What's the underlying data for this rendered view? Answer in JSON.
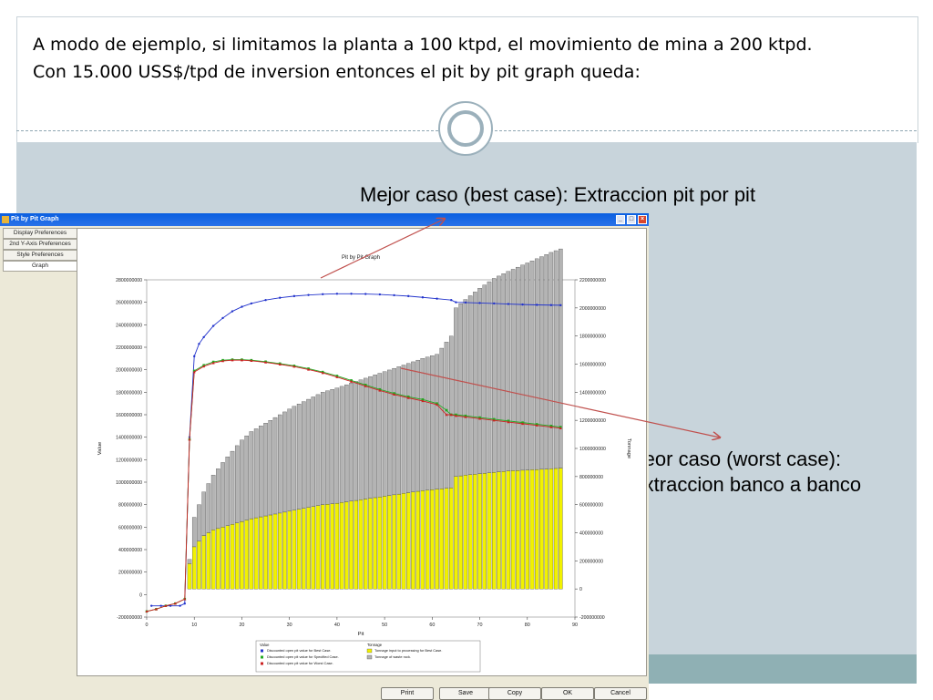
{
  "slide": {
    "intro_line1": "A modo de ejemplo, si limitamos la planta a 100 ktpd, el movimiento de mina a 200 ktpd.",
    "intro_line2": "Con 15.000 USS$/tpd de inversion entonces el pit by pit graph queda:",
    "callout_best": "Mejor caso (best case): Extraccion pit por pit",
    "callout_worst_line1": "Peor caso (worst case):",
    "callout_worst_line2": "Extraccion banco a banco",
    "accent_color": "#c0504d"
  },
  "window": {
    "title": "Pit by Pit Graph",
    "nav": [
      "Display Preferences",
      "2nd Y-Axis Preferences",
      "Style Preferences",
      "Graph"
    ],
    "buttons": {
      "print": "Print",
      "save": "Save",
      "copy": "Copy",
      "ok": "OK",
      "cancel": "Cancel"
    }
  },
  "chart_data": {
    "type": "bar",
    "title": "Pit by Pit Graph",
    "xlabel": "Pit",
    "ylabel": "Value",
    "y2label": "Tonnage",
    "xlim": [
      0,
      90
    ],
    "ylim": [
      -200000000,
      2800000000
    ],
    "y2lim": [
      -200000000,
      2200000000
    ],
    "x_ticks": [
      "0",
      "10",
      "20",
      "30",
      "40",
      "50",
      "60",
      "70",
      "80",
      "90"
    ],
    "y_ticks": [
      "-200000000",
      "0",
      "200000000",
      "400000000",
      "600000000",
      "800000000",
      "1000000000",
      "1200000000",
      "1400000000",
      "1600000000",
      "1800000000",
      "2000000000",
      "2200000000",
      "2400000000",
      "2600000000",
      "2800000000"
    ],
    "y2_ticks": [
      "-200000000",
      "0",
      "200000000",
      "400000000",
      "600000000",
      "800000000",
      "1000000000",
      "1200000000",
      "1400000000",
      "1600000000",
      "1800000000",
      "2000000000",
      "2200000000"
    ],
    "legend": {
      "value_header": "Value",
      "tonnage_header": "Tonnage",
      "position": "bottom-center",
      "items": [
        {
          "label": "Discounted open pit value for Best Case.",
          "color": "#2233cc",
          "marker": "star"
        },
        {
          "label": "Discounted open pit value for Specified Case.",
          "color": "#22aa22",
          "marker": "square"
        },
        {
          "label": "Discounted open pit value for Worst Case.",
          "color": "#cc2222",
          "marker": "triangle"
        },
        {
          "label": "Tonnage input to processing for Best Case.",
          "color": "#f2f200",
          "marker": "box"
        },
        {
          "label": "Tonnage of waste rock.",
          "color": "#b4b4b4",
          "marker": "box"
        }
      ]
    },
    "series": [
      {
        "name": "Discounted open pit value for Best Case.",
        "axis": "left",
        "x": [
          1,
          3,
          5,
          7,
          8,
          9,
          10,
          11,
          12,
          14,
          16,
          18,
          20,
          22,
          25,
          28,
          31,
          34,
          37,
          40,
          43,
          46,
          49,
          52,
          55,
          58,
          61,
          64,
          65,
          67,
          70,
          73,
          76,
          79,
          82,
          85,
          87
        ],
        "y": [
          -100000000,
          -100000000,
          -100000000,
          -100000000,
          -80000000,
          1400000000,
          2120000000,
          2230000000,
          2290000000,
          2390000000,
          2460000000,
          2520000000,
          2560000000,
          2590000000,
          2620000000,
          2640000000,
          2655000000,
          2665000000,
          2672000000,
          2676000000,
          2676000000,
          2674000000,
          2670000000,
          2663000000,
          2655000000,
          2644000000,
          2632000000,
          2620000000,
          2600000000,
          2598000000,
          2594000000,
          2590000000,
          2585000000,
          2580000000,
          2577000000,
          2575000000,
          2574000000
        ]
      },
      {
        "name": "Discounted open pit value for Specified Case.",
        "axis": "left",
        "x": [
          0,
          2,
          4,
          6,
          8,
          9,
          10,
          12,
          14,
          16,
          18,
          20,
          22,
          25,
          28,
          31,
          34,
          37,
          40,
          43,
          46,
          49,
          52,
          55,
          58,
          61,
          63,
          64,
          65,
          67,
          70,
          73,
          76,
          79,
          82,
          85,
          87
        ],
        "y": [
          -150000000,
          -130000000,
          -100000000,
          -80000000,
          -40000000,
          1380000000,
          1990000000,
          2040000000,
          2070000000,
          2085000000,
          2090000000,
          2090000000,
          2085000000,
          2072000000,
          2055000000,
          2035000000,
          2010000000,
          1980000000,
          1945000000,
          1905000000,
          1865000000,
          1825000000,
          1790000000,
          1760000000,
          1735000000,
          1700000000,
          1640000000,
          1600000000,
          1600000000,
          1590000000,
          1575000000,
          1560000000,
          1545000000,
          1530000000,
          1515000000,
          1500000000,
          1490000000
        ]
      },
      {
        "name": "Discounted open pit value for Worst Case.",
        "axis": "left",
        "x": [
          0,
          2,
          4,
          6,
          8,
          9,
          10,
          12,
          14,
          16,
          18,
          20,
          22,
          25,
          28,
          31,
          34,
          37,
          40,
          43,
          46,
          49,
          52,
          55,
          58,
          61,
          63,
          64,
          65,
          67,
          70,
          73,
          76,
          79,
          82,
          85,
          87
        ],
        "y": [
          -150000000,
          -130000000,
          -100000000,
          -80000000,
          -40000000,
          1380000000,
          1980000000,
          2030000000,
          2060000000,
          2078000000,
          2085000000,
          2085000000,
          2080000000,
          2066000000,
          2048000000,
          2028000000,
          2002000000,
          1972000000,
          1935000000,
          1895000000,
          1855000000,
          1815000000,
          1780000000,
          1750000000,
          1722000000,
          1690000000,
          1600000000,
          1600000000,
          1590000000,
          1580000000,
          1565000000,
          1550000000,
          1535000000,
          1520000000,
          1505000000,
          1490000000,
          1480000000
        ]
      },
      {
        "name": "Tonnage input to processing for Best Case.",
        "axis": "right",
        "kind": "bar",
        "x": [
          9,
          10,
          11,
          12,
          14,
          16,
          18,
          20,
          22,
          25,
          28,
          31,
          34,
          37,
          40,
          43,
          46,
          49,
          52,
          55,
          58,
          61,
          64,
          65,
          67,
          70,
          73,
          76,
          79,
          82,
          85,
          87
        ],
        "y": [
          180000000,
          300000000,
          340000000,
          380000000,
          420000000,
          440000000,
          460000000,
          480000000,
          500000000,
          520000000,
          540000000,
          560000000,
          580000000,
          600000000,
          610000000,
          625000000,
          640000000,
          655000000,
          670000000,
          685000000,
          700000000,
          710000000,
          720000000,
          800000000,
          810000000,
          820000000,
          830000000,
          840000000,
          845000000,
          850000000,
          855000000,
          860000000
        ]
      },
      {
        "name": "Tonnage of waste rock.",
        "axis": "right",
        "kind": "bar",
        "x": [
          9,
          10,
          11,
          12,
          14,
          16,
          18,
          20,
          22,
          25,
          28,
          31,
          34,
          37,
          40,
          43,
          46,
          49,
          52,
          55,
          58,
          61,
          64,
          65,
          67,
          70,
          73,
          76,
          79,
          82,
          85,
          87
        ],
        "y": [
          30000000,
          210000000,
          260000000,
          310000000,
          390000000,
          460000000,
          520000000,
          580000000,
          620000000,
          660000000,
          700000000,
          740000000,
          770000000,
          800000000,
          820000000,
          840000000,
          860000000,
          880000000,
          900000000,
          920000000,
          940000000,
          960000000,
          1080000000,
          1200000000,
          1250000000,
          1320000000,
          1380000000,
          1420000000,
          1460000000,
          1500000000,
          1540000000,
          1560000000
        ]
      }
    ]
  }
}
